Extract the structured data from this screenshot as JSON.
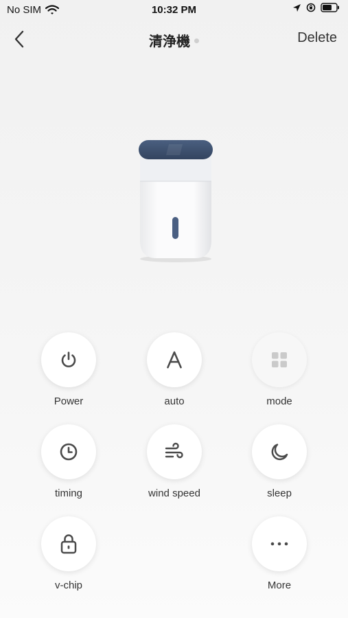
{
  "status_bar": {
    "carrier": "No SIM",
    "time": "10:32 PM"
  },
  "nav": {
    "title": "清浄機",
    "delete_label": "Delete"
  },
  "device": {
    "name_icon": "air-purifier-image"
  },
  "controls": [
    {
      "label": "Power",
      "icon": "power-icon",
      "enabled": true
    },
    {
      "label": "auto",
      "icon": "letter-a-icon",
      "enabled": true
    },
    {
      "label": "mode",
      "icon": "grid-icon",
      "enabled": false
    },
    {
      "label": "timing",
      "icon": "clock-icon",
      "enabled": true
    },
    {
      "label": "wind speed",
      "icon": "wind-icon",
      "enabled": true
    },
    {
      "label": "sleep",
      "icon": "moon-icon",
      "enabled": true
    },
    {
      "label": "v-chip",
      "icon": "lock-icon",
      "enabled": true
    },
    {
      "label": "More",
      "icon": "more-icon",
      "enabled": true
    }
  ],
  "colors": {
    "icon": "#4a4a4a",
    "icon_disabled": "#c8c8c8",
    "device_panel": "#3e5172"
  }
}
